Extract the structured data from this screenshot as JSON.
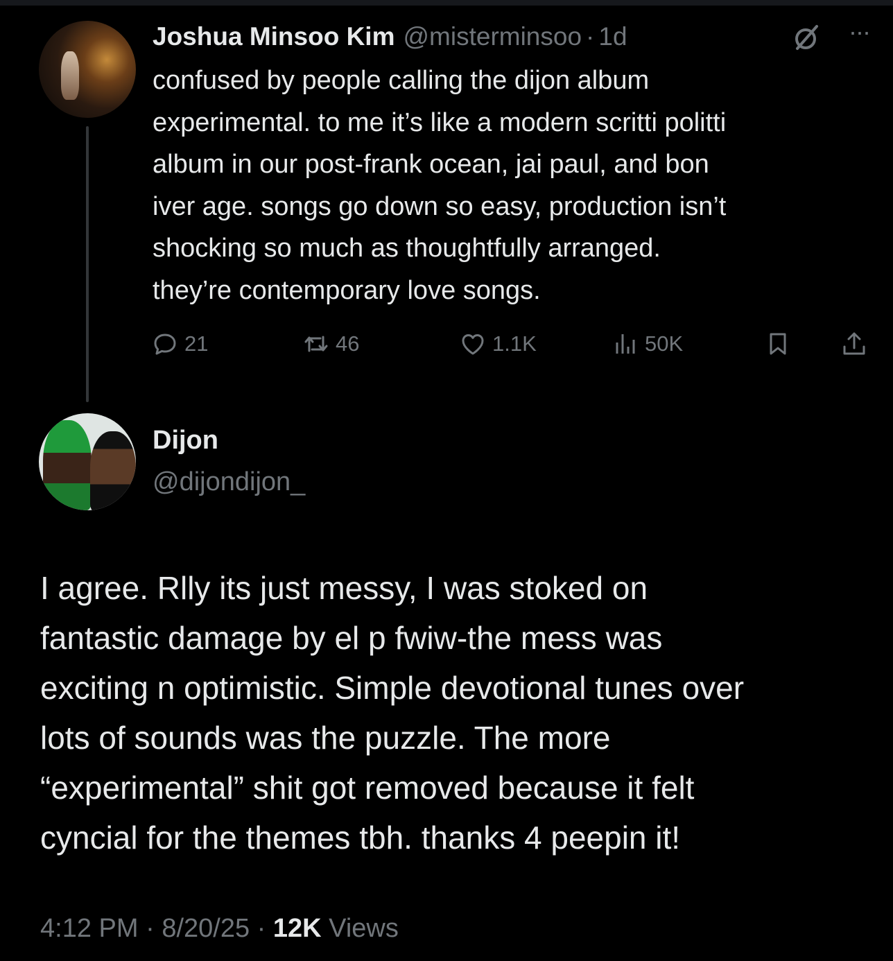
{
  "colors": {
    "background": "#000000",
    "text": "#e7e9ea",
    "muted": "#71767b",
    "thread_line": "#333639"
  },
  "parent_tweet": {
    "display_name": "Joshua Minsoo Kim",
    "handle": "@misterminsoo",
    "separator": "·",
    "time": "1d",
    "text": "confused by people calling the dijon album\nexperimental. to me it’s like a modern scritti politti\nalbum in our post-frank ocean, jai paul, and bon\niver age. songs go down so easy, production isn’t\nshocking so much as thoughtfully arranged.\nthey’re contemporary love songs.",
    "icons": {
      "grok": "grok-icon",
      "more": "more-icon"
    },
    "more_glyph": "···",
    "stats": {
      "replies": "21",
      "reposts": "46",
      "likes": "1.1K",
      "views": "50K"
    }
  },
  "reply_tweet": {
    "display_name": "Dijon",
    "handle": "@dijondijon_",
    "text": "I agree. Rlly its just messy, I was stoked on\nfantastic damage by el p fwiw-the mess was\nexciting n optimistic. Simple devotional tunes over\nlots of sounds was the puzzle. The more\n“experimental” shit got removed because it felt\ncyncial for the themes tbh. thanks 4 peepin it!",
    "footer": {
      "time": "4:12 PM",
      "sep1": " · ",
      "date": "8/20/25",
      "sep2": " · ",
      "views_count": "12K",
      "views_label": " Views"
    }
  }
}
